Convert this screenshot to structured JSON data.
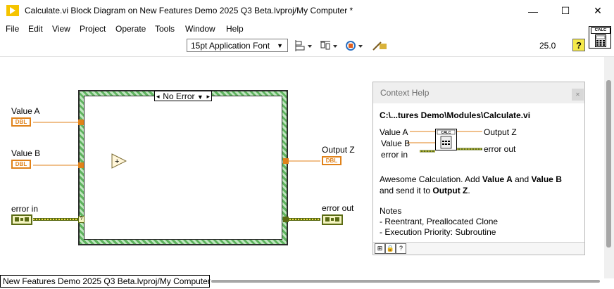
{
  "window": {
    "title": "Calculate.vi Block Diagram on New Features Demo 2025 Q3 Beta.lvproj/My Computer *",
    "minimize": "—",
    "maximize": "☐",
    "close": "✕"
  },
  "menu": [
    "File",
    "Edit",
    "View",
    "Project",
    "Operate",
    "Tools",
    "Window",
    "Help"
  ],
  "toolbar": {
    "font": "15pt Application Font",
    "zoom": "25.0",
    "help": "?"
  },
  "vi_icon": {
    "label": "CALC"
  },
  "diagram": {
    "controls": [
      {
        "label": "Value A",
        "type": "DBL"
      },
      {
        "label": "Value B",
        "type": "DBL"
      },
      {
        "label": "error in",
        "type": "error"
      }
    ],
    "indicators": [
      {
        "label": "Output Z",
        "type": "DBL"
      },
      {
        "label": "error out",
        "type": "error"
      }
    ],
    "case_selector": "No Error",
    "node": "+"
  },
  "context_help": {
    "title": "Context Help",
    "path": "C:\\...tures Demo\\Modules\\Calculate.vi",
    "conn": {
      "in_a": "Value A",
      "in_b": "Value B",
      "err_in": "error in",
      "out_z": "Output Z",
      "err_out": "error out",
      "icon_label": "CALC"
    },
    "desc_1": "Awesome Calculation. Add ",
    "desc_b1": "Value A",
    "desc_2": " and ",
    "desc_b2": "Value B",
    "desc_3": "and send it to ",
    "desc_b3": "Output Z",
    "desc_4": ".",
    "notes_title": "Notes",
    "note_1": "- Reentrant, Preallocated Clone",
    "note_2": "- Execution Priority: Subroutine"
  },
  "status": "New Features Demo 2025 Q3 Beta.lvproj/My Computer",
  "colors": {
    "dbl": "#e0821a",
    "error": "#5a6b14",
    "case_border": "#5fb45f"
  }
}
